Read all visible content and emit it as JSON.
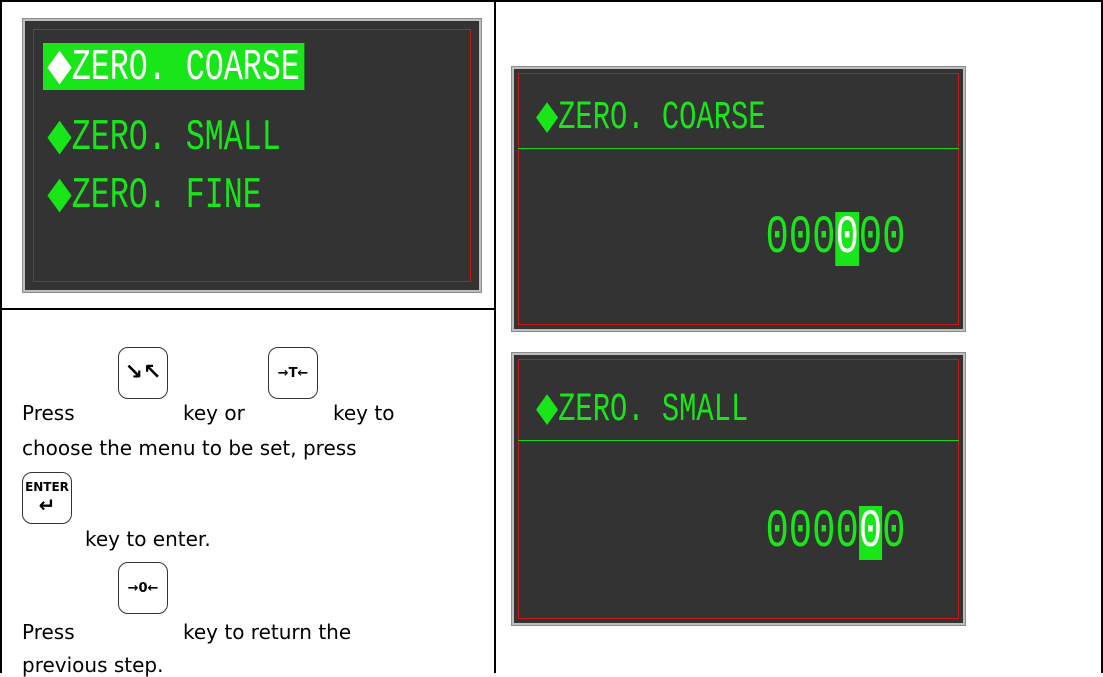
{
  "menu_screen": {
    "items": [
      {
        "label": "ZERO. COARSE",
        "selected": true
      },
      {
        "label": "ZERO. SMALL",
        "selected": false
      },
      {
        "label": "ZERO. FINE",
        "selected": false
      }
    ]
  },
  "coarse_screen": {
    "title": "ZERO. COARSE",
    "digits": [
      "0",
      "0",
      "0",
      "0",
      "0",
      "0"
    ],
    "cursor_index": 3
  },
  "small_screen": {
    "title": "ZERO. SMALL",
    "digits": [
      "0",
      "0",
      "0",
      "0",
      "0",
      "0"
    ],
    "cursor_index": 4
  },
  "diamond": "◆",
  "keys": {
    "select": "↘↖",
    "tare": "→T←",
    "enter_label": "ENTER",
    "enter_arrow": "↵",
    "zero": "→0←"
  },
  "instructions": {
    "line1_a": "Press",
    "line1_b": "key or",
    "line1_c": "key to",
    "line2": "choose the menu to be set, press",
    "line3": "key to enter.",
    "line4_a": "Press",
    "line4_b": "key to return the",
    "line5": "previous step."
  },
  "colors": {
    "lcd_background": "#333333",
    "lcd_text": "#19e619",
    "lcd_frame": "#c81818"
  }
}
